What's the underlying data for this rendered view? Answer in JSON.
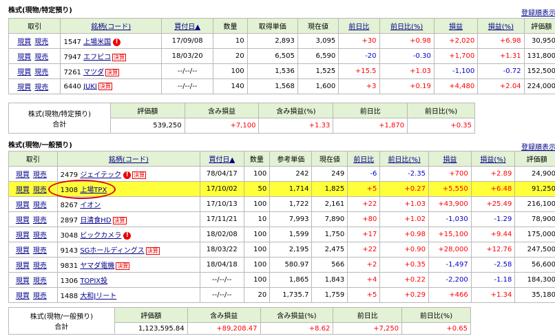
{
  "sec1": {
    "title": "株式(現物/特定預り)",
    "register_link": "登録順表示",
    "headers": [
      "取引",
      "銘柄(コード)",
      "買付日▲",
      "数量",
      "取得単価",
      "現在値",
      "前日比",
      "前日比(%)",
      "損益",
      "損益(%)",
      "評価額"
    ],
    "rows": [
      {
        "buy": "現買",
        "sell": "現売",
        "code": "1547",
        "name": "上場米国",
        "badge": "",
        "alert": "!",
        "date": "17/09/08",
        "qty": "10",
        "cost": "2,893",
        "price": "3,095",
        "chg": "+30",
        "chgp": "+0.98",
        "pl": "+2,020",
        "plp": "+6.98",
        "val": "30,950"
      },
      {
        "buy": "現買",
        "sell": "現売",
        "code": "7947",
        "name": "エフピコ",
        "badge": "決算",
        "alert": "",
        "date": "18/03/20",
        "qty": "20",
        "cost": "6,505",
        "price": "6,590",
        "chg": "-20",
        "chgp": "-0.30",
        "pl": "+1,700",
        "plp": "+1.31",
        "val": "131,800"
      },
      {
        "buy": "現買",
        "sell": "現売",
        "code": "7261",
        "name": "マツダ",
        "badge": "決算",
        "alert": "",
        "date": "--/--/--",
        "qty": "100",
        "cost": "1,536",
        "price": "1,525",
        "chg": "+15.5",
        "chgp": "+1.03",
        "pl": "-1,100",
        "plp": "-0.72",
        "val": "152,500"
      },
      {
        "buy": "現買",
        "sell": "現売",
        "code": "6440",
        "name": "JUKI",
        "badge": "決算",
        "alert": "",
        "date": "--/--/--",
        "qty": "140",
        "cost": "1,568",
        "price": "1,600",
        "chg": "+3",
        "chgp": "+0.19",
        "pl": "+4,480",
        "plp": "+2.04",
        "val": "224,000"
      }
    ],
    "summary": {
      "label1": "株式(現物/特定預り)",
      "label2": "合計",
      "headers": [
        "評価額",
        "含み損益",
        "含み損益(%)",
        "前日比",
        "前日比(%)"
      ],
      "values": [
        "539,250",
        "+7,100",
        "+1.33",
        "+1,870",
        "+0.35"
      ]
    }
  },
  "sec2": {
    "title": "株式(現物/一般預り)",
    "register_link": "登録順表示",
    "headers": [
      "取引",
      "銘柄(コード)",
      "買付日▲",
      "数量",
      "参考単価",
      "現在値",
      "前日比",
      "前日比(%)",
      "損益",
      "損益(%)",
      "評価額"
    ],
    "rows": [
      {
        "buy": "現買",
        "sell": "現売",
        "code": "2479",
        "name": "ジェイテック",
        "badge": "決算",
        "alert": "!",
        "date": "78/04/17",
        "qty": "100",
        "cost": "242",
        "price": "249",
        "chg": "-6",
        "chgp": "-2.35",
        "pl": "+700",
        "plp": "+2.89",
        "val": "24,900"
      },
      {
        "buy": "現買",
        "sell": "現売",
        "code": "1308",
        "name": "上場TPX",
        "badge": "",
        "alert": "",
        "date": "17/10/02",
        "qty": "50",
        "cost": "1,714",
        "price": "1,825",
        "chg": "+5",
        "chgp": "+0.27",
        "pl": "+5,550",
        "plp": "+6.48",
        "val": "91,250",
        "highlight": true
      },
      {
        "buy": "現買",
        "sell": "現売",
        "code": "8267",
        "name": "イオン",
        "badge": "",
        "alert": "",
        "date": "17/10/13",
        "qty": "100",
        "cost": "1,722",
        "price": "2,161",
        "chg": "+22",
        "chgp": "+1.03",
        "pl": "+43,900",
        "plp": "+25.49",
        "val": "216,100"
      },
      {
        "buy": "現買",
        "sell": "現売",
        "code": "2897",
        "name": "日清食HD",
        "badge": "決算",
        "alert": "",
        "date": "17/11/21",
        "qty": "10",
        "cost": "7,993",
        "price": "7,890",
        "chg": "+80",
        "chgp": "+1.02",
        "pl": "-1,030",
        "plp": "-1.29",
        "val": "78,900"
      },
      {
        "buy": "現買",
        "sell": "現売",
        "code": "3048",
        "name": "ビックカメラ",
        "badge": "",
        "alert": "!",
        "date": "18/02/08",
        "qty": "100",
        "cost": "1,599",
        "price": "1,750",
        "chg": "+17",
        "chgp": "+0.98",
        "pl": "+15,100",
        "plp": "+9.44",
        "val": "175,000"
      },
      {
        "buy": "現買",
        "sell": "現売",
        "code": "9143",
        "name": "SGホールディングス",
        "badge": "決算",
        "alert": "",
        "date": "18/03/22",
        "qty": "100",
        "cost": "2,195",
        "price": "2,475",
        "chg": "+22",
        "chgp": "+0.90",
        "pl": "+28,000",
        "plp": "+12.76",
        "val": "247,500"
      },
      {
        "buy": "現買",
        "sell": "現売",
        "code": "9831",
        "name": "ヤマダ電機",
        "badge": "決算",
        "alert": "",
        "date": "18/04/18",
        "qty": "100",
        "cost": "580.97",
        "price": "566",
        "chg": "+2",
        "chgp": "+0.35",
        "pl": "-1,497",
        "plp": "-2.58",
        "val": "56,600"
      },
      {
        "buy": "現買",
        "sell": "現売",
        "code": "1306",
        "name": "TOPIX投",
        "badge": "",
        "alert": "",
        "date": "--/--/--",
        "qty": "100",
        "cost": "1,865",
        "price": "1,843",
        "chg": "+4",
        "chgp": "+0.22",
        "pl": "-2,200",
        "plp": "-1.18",
        "val": "184,300"
      },
      {
        "buy": "現買",
        "sell": "現売",
        "code": "1488",
        "name": "大和Jリート",
        "badge": "",
        "alert": "",
        "date": "--/--/--",
        "qty": "20",
        "cost": "1,735.7",
        "price": "1,759",
        "chg": "+5",
        "chgp": "+0.29",
        "pl": "+466",
        "plp": "+1.34",
        "val": "35,180"
      }
    ],
    "summary": {
      "label1": "株式(現物/一般預り)",
      "label2": "合計",
      "headers": [
        "評価額",
        "含み損益",
        "含み損益(%)",
        "前日比",
        "前日比(%)"
      ],
      "values": [
        "1,123,595.84",
        "+89,208.47",
        "+8.62",
        "+7,250",
        "+0.65"
      ]
    }
  },
  "colors": {
    "header_bg": "#e3f1d4",
    "positive": "#ff0000",
    "negative": "#0000cc",
    "highlight": "#ffff3a",
    "link": "#00008b"
  }
}
